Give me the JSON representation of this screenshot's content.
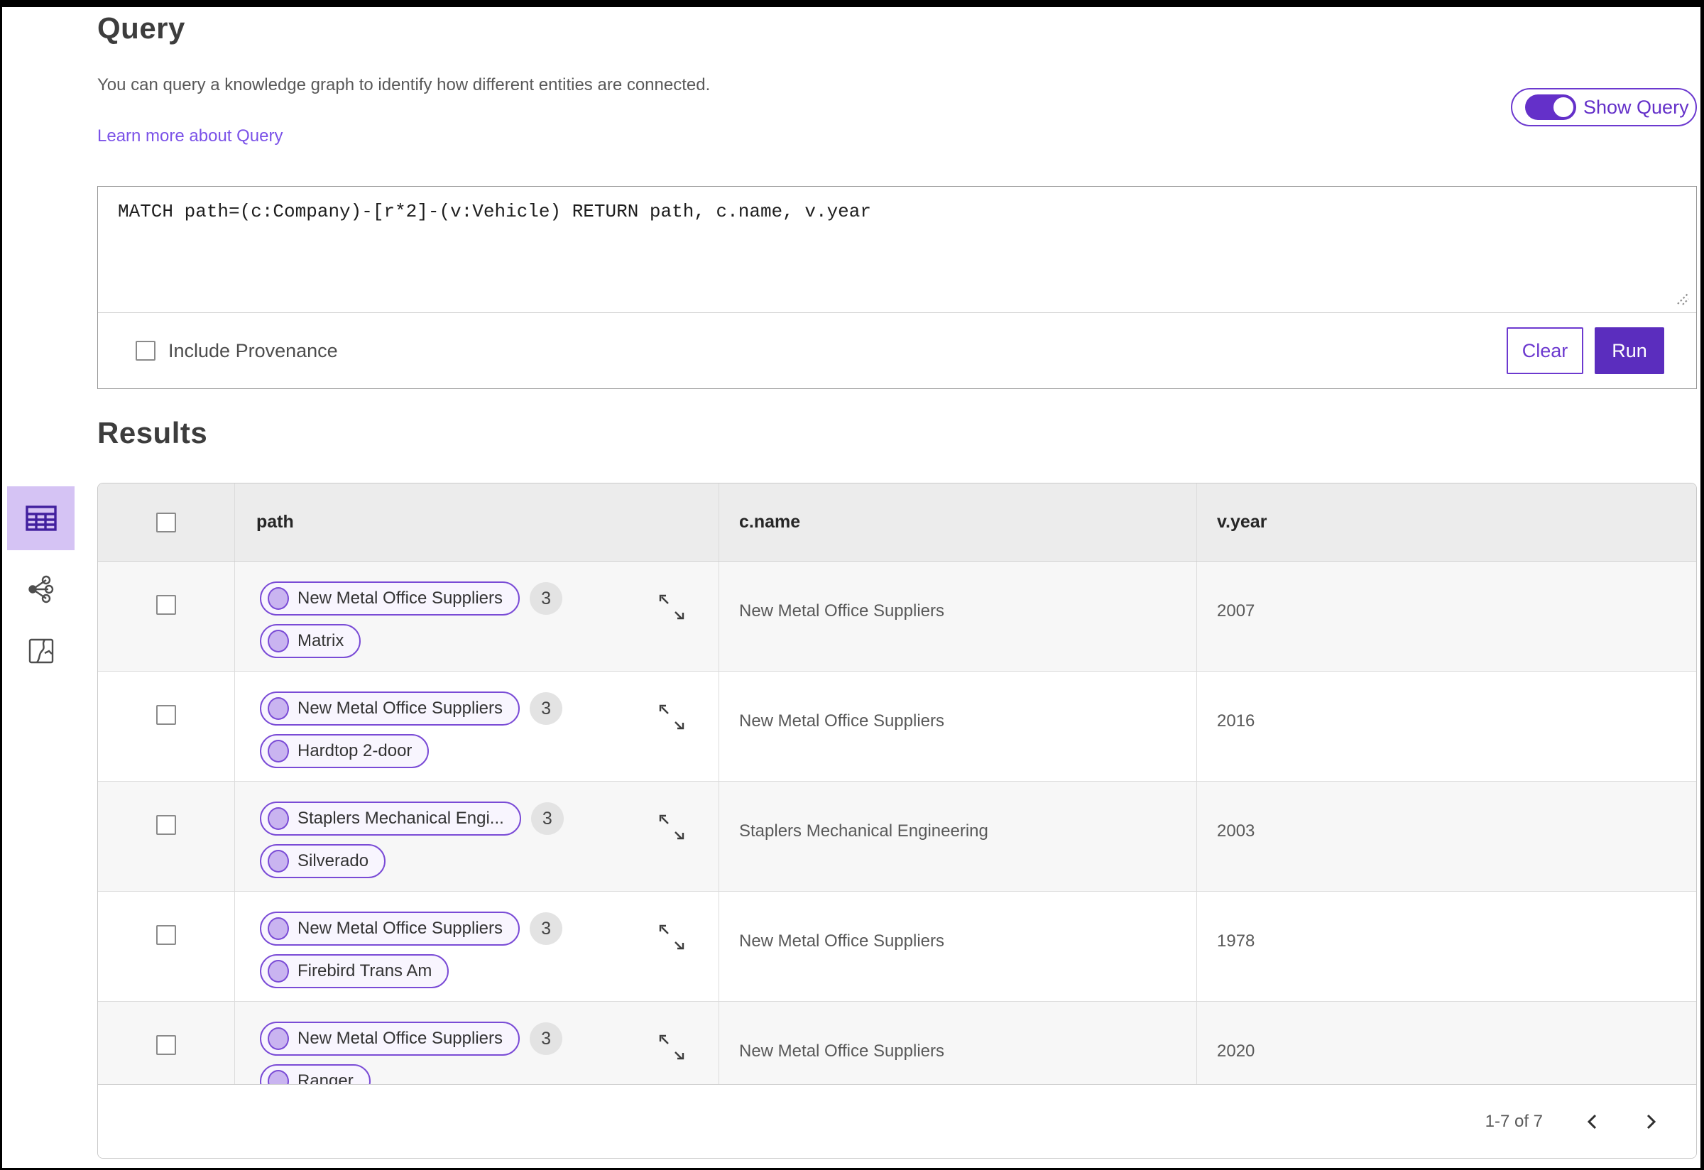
{
  "header": {
    "title": "Query",
    "description": "You can query a knowledge graph to identify how different entities are connected.",
    "learn_more_link": "Learn more about Query",
    "show_query_label": "Show Query",
    "show_query_on": true
  },
  "query_panel": {
    "query_text": "MATCH path=(c:Company)-[r*2]-(v:Vehicle) RETURN path, c.name, v.year",
    "include_provenance_label": "Include Provenance",
    "include_provenance_checked": false,
    "clear_button": "Clear",
    "run_button": "Run"
  },
  "results": {
    "title": "Results",
    "columns": {
      "path": "path",
      "c_name": "c.name",
      "v_year": "v.year"
    },
    "rows": [
      {
        "path_nodes": [
          "New Metal Office Suppliers",
          "Matrix"
        ],
        "path_count": "3",
        "c_name": "New Metal Office Suppliers",
        "v_year": "2007"
      },
      {
        "path_nodes": [
          "New Metal Office Suppliers",
          "Hardtop 2-door"
        ],
        "path_count": "3",
        "c_name": "New Metal Office Suppliers",
        "v_year": "2016"
      },
      {
        "path_nodes": [
          "Staplers Mechanical Engi...",
          "Silverado"
        ],
        "path_count": "3",
        "c_name": "Staplers Mechanical Engineering",
        "v_year": "2003"
      },
      {
        "path_nodes": [
          "New Metal Office Suppliers",
          "Firebird Trans Am"
        ],
        "path_count": "3",
        "c_name": "New Metal Office Suppliers",
        "v_year": "1978"
      },
      {
        "path_nodes": [
          "New Metal Office Suppliers",
          "Ranger"
        ],
        "path_count": "3",
        "c_name": "New Metal Office Suppliers",
        "v_year": "2020"
      }
    ],
    "pagination": {
      "range_label": "1-7 of 7"
    }
  },
  "sidebar": {
    "views": [
      {
        "id": "table-view",
        "icon": "table-icon",
        "selected": true
      },
      {
        "id": "graph-view",
        "icon": "network-icon",
        "selected": false
      },
      {
        "id": "map-view",
        "icon": "map-icon",
        "selected": false
      }
    ]
  },
  "icons": {
    "table_view": "table-grid",
    "graph_view": "network-nodes",
    "map_view": "map-route",
    "path_expand": "diagonal-expand-arrows",
    "pagination_prev": "chevron-left",
    "pagination_next": "chevron-right",
    "textarea_resize": "diagonal-grip"
  },
  "colors": {
    "accent_purple": "#6430c9",
    "run_button_bg": "#5b2dbe",
    "link_purple": "#7b52e8",
    "pill_border": "#7a4bd6",
    "pill_fill": "#f8f5fe",
    "node_circle_fill": "#c9b4f0",
    "selected_tile_bg": "#d5c3f4",
    "header_row_bg": "#ececec",
    "alt_row_bg": "#f7f7f7",
    "frame_black": "#000000"
  }
}
